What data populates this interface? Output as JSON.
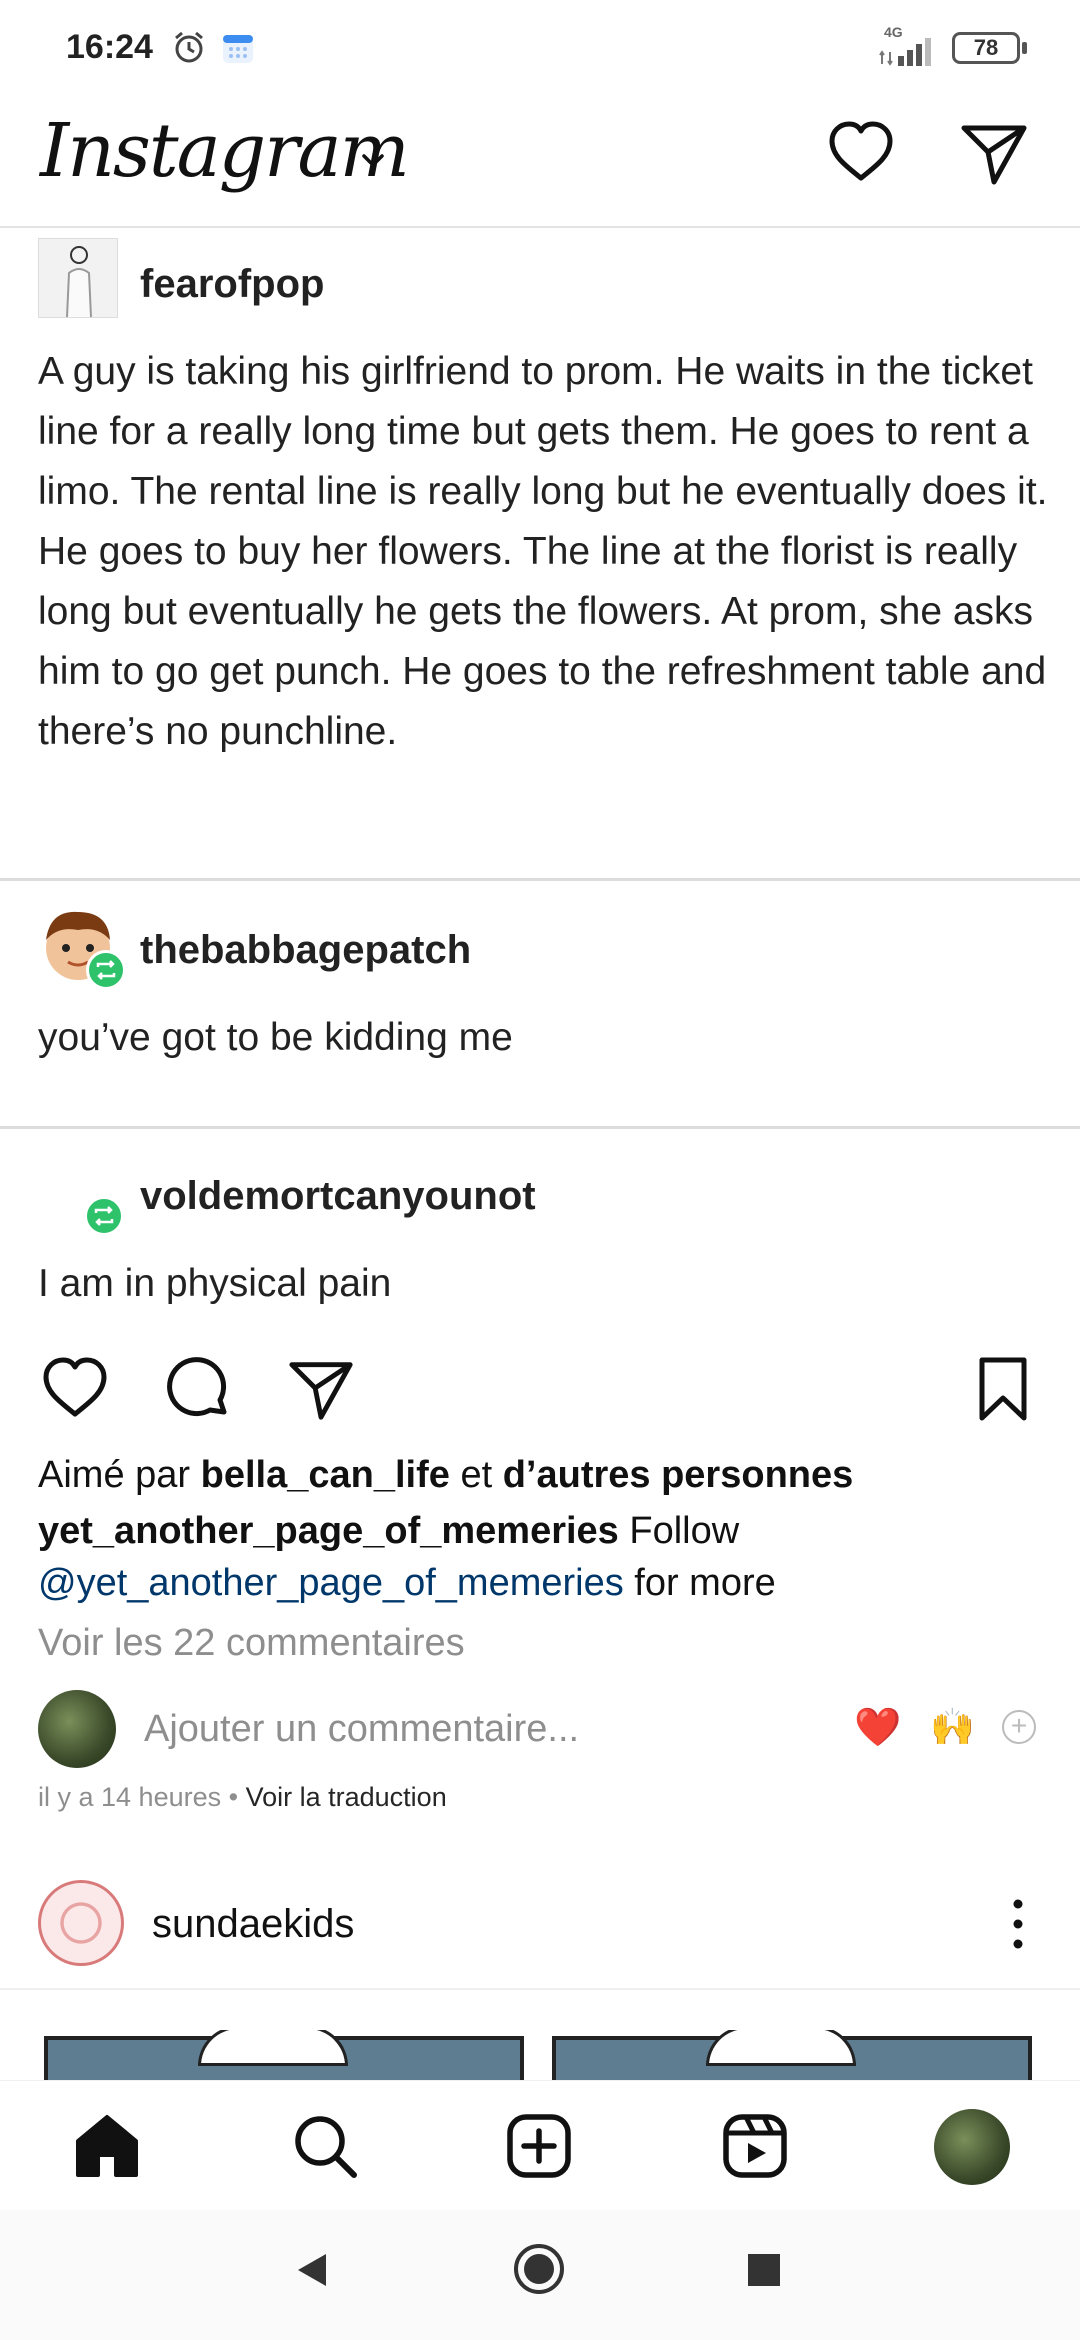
{
  "status_bar": {
    "time": "16:24",
    "network": "4G",
    "battery": "78"
  },
  "header": {
    "logo": "Instagram",
    "icons": [
      "chevron-down-icon",
      "heart-icon",
      "direct-send-icon"
    ]
  },
  "post": {
    "tumblr_thread": [
      {
        "username": "fearofpop",
        "text": "A guy is taking his girlfriend to prom. He waits in the ticket line for a really long time but gets them. He goes to rent a limo. The rental line is really long but he eventually does it. He goes to buy her flowers. The line at the florist is really long but eventually he gets the flowers. At prom, she asks him to go get punch. He goes to the refreshment table and there’s no punchline."
      },
      {
        "username": "thebabbagepatch",
        "text": "you’ve got to be kidding me"
      },
      {
        "username": "voldemortcanyounot",
        "text": "I am in physical pain"
      }
    ],
    "likes": {
      "prefix": "Aimé par",
      "user": "bella_can_life",
      "joiner": "et",
      "others": "d’autres personnes"
    },
    "caption": {
      "username": "yet_another_page_of_memeries",
      "text": "Follow",
      "mention": "@yet_another_page_of_memeries",
      "suffix": "for more"
    },
    "view_comments": "Voir les 22 commentaires",
    "comment_placeholder": "Ajouter un commentaire...",
    "quick_reactions": [
      "❤️",
      "🙌"
    ],
    "time_ago": "il y a 14 heures",
    "separator": "•",
    "translate": "Voir la traduction"
  },
  "next_post": {
    "username": "sundaekids"
  },
  "colors": {
    "reblog_green": "#2ec26b",
    "mention_blue": "#00376b",
    "muted_grey": "#8e8e8e"
  }
}
